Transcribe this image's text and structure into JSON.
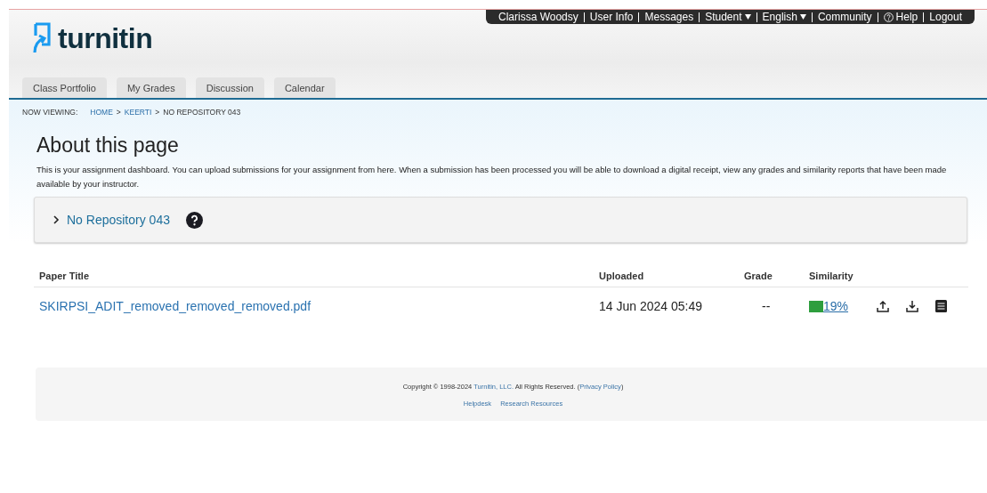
{
  "top_nav": [
    {
      "label": "Clarissa Woodsy",
      "kind": "link"
    },
    {
      "label": "User Info",
      "kind": "link"
    },
    {
      "label": "Messages",
      "kind": "link"
    },
    {
      "label": "Student",
      "kind": "menu"
    },
    {
      "label": "English",
      "kind": "menu"
    },
    {
      "label": "Community",
      "kind": "link"
    },
    {
      "label": "Help",
      "kind": "help"
    },
    {
      "label": "Logout",
      "kind": "link"
    }
  ],
  "logo": {
    "text": "turnitin"
  },
  "tabs": [
    "Class Portfolio",
    "My Grades",
    "Discussion",
    "Calendar"
  ],
  "breadcrumb": {
    "label": "NOW VIEWING:",
    "links": [
      "HOME",
      "KEERTI"
    ],
    "separator": ">",
    "current": "NO REPOSITORY 043"
  },
  "about": {
    "title": "About this page",
    "text": "This is your assignment dashboard. You can upload submissions for your assignment from here. When a submission has been processed you will be able to download a digital receipt, view any grades and similarity reports that have been made available by your instructor."
  },
  "assignment": {
    "title": "No Repository 043",
    "expanded": false
  },
  "table": {
    "columns": [
      "Paper Title",
      "Uploaded",
      "Grade",
      "Similarity"
    ],
    "rows": [
      {
        "title": "SKIRPSI_ADIT_removed_removed_removed.pdf",
        "uploaded": "14 Jun 2024 05:49",
        "grade": "--",
        "similarity": "19%"
      }
    ]
  },
  "footer": {
    "copyright": [
      {
        "kind": "text",
        "text": "Copyright © 1998-2024 "
      },
      {
        "kind": "link",
        "text": "Turnitin, LLC."
      },
      {
        "kind": "text",
        "text": " All Rights Reserved. ("
      },
      {
        "kind": "link",
        "text": "Privacy Policy"
      },
      {
        "kind": "text",
        "text": ")"
      }
    ],
    "links": [
      "Helpdesk",
      "Research Resources"
    ]
  }
}
